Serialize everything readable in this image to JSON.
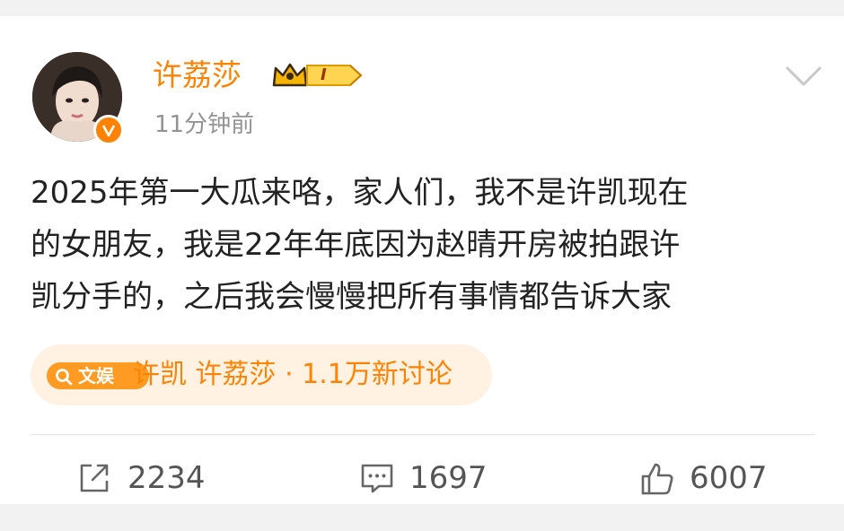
{
  "post": {
    "username": "许荔莎",
    "level": "I",
    "timestamp": "11分钟前",
    "text": "2025年第一大瓜来咯，家人们，我不是许凯现在\n的女朋友，我是22年年底因为赵晴开房被拍跟许\n凯分手的，之后我会慢慢把所有事情都告诉大家",
    "brand_color": "#ff8200"
  },
  "topic": {
    "badge_label": "文娱",
    "text": "许凯 许荔莎 · 1.1万新讨论"
  },
  "actions": {
    "repost_count": "2234",
    "comment_count": "1697",
    "like_count": "6007"
  },
  "icons": {
    "avatar": "avatar",
    "verified": "verified-v-icon",
    "crown": "crown-icon",
    "dropdown": "chevron-down-icon",
    "search": "search-icon",
    "repost": "share-icon",
    "comment": "comment-icon",
    "like": "thumbs-up-icon"
  }
}
